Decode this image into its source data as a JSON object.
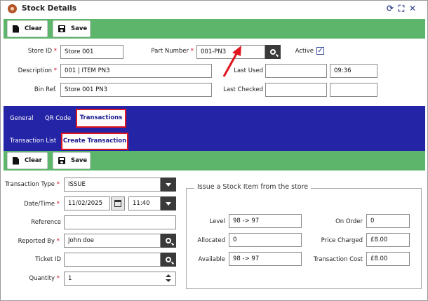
{
  "window": {
    "title": "Stock Details",
    "icon": "stock-gear-icon"
  },
  "title_controls": {
    "refresh": "refresh-icon",
    "expand": "expand-icon",
    "close": "close-icon"
  },
  "toolbar_top": {
    "clear_label": "Clear",
    "save_label": "Save"
  },
  "header_form": {
    "store_id": {
      "label": "Store ID",
      "value": "Store 001"
    },
    "part_number": {
      "label": "Part Number",
      "value": "001-PN3"
    },
    "active": {
      "label": "Active",
      "checked": true
    },
    "description": {
      "label": "Description",
      "value": "001 | ITEM PN3"
    },
    "last_used": {
      "label": "Last Used",
      "date": "",
      "time": "09:36"
    },
    "bin_ref": {
      "label": "Bin Ref.",
      "value": "Store 001 PN3"
    },
    "last_checked": {
      "label": "Last Checked",
      "date": "",
      "time": ""
    }
  },
  "tabs": [
    {
      "label": "General"
    },
    {
      "label": "QR Code"
    },
    {
      "label": "Transactions",
      "active": true
    }
  ],
  "subtabs": [
    {
      "label": "Transaction List"
    },
    {
      "label": "Create Transaction",
      "active": true
    }
  ],
  "toolbar_trans": {
    "clear_label": "Clear",
    "save_label": "Save"
  },
  "transaction_form": {
    "type": {
      "label": "Transaction Type",
      "value": "ISSUE"
    },
    "datetime": {
      "label": "Date/Time",
      "date": "11/02/2025",
      "time": "11:40"
    },
    "reference": {
      "label": "Reference",
      "value": ""
    },
    "reported_by": {
      "label": "Reported By",
      "value": "John doe"
    },
    "ticket_id": {
      "label": "Ticket ID",
      "value": ""
    },
    "quantity": {
      "label": "Quantity",
      "value": "1"
    }
  },
  "issue_group": {
    "title": "Issue a Stock Item from the store",
    "level": {
      "label": "Level",
      "value": "98 -> 97"
    },
    "allocated": {
      "label": "Allocated",
      "value": "0"
    },
    "available": {
      "label": "Available",
      "value": "98 -> 97"
    },
    "on_order": {
      "label": "On Order",
      "value": "0"
    },
    "price_charged": {
      "label": "Price Charged",
      "value": "£8.00"
    },
    "transaction_cost": {
      "label": "Transaction Cost",
      "value": "£8.00"
    }
  },
  "colors": {
    "accent_green": "#5cb56b",
    "nav_blue": "#2424a6",
    "highlight_red": "#e0141d",
    "required_red": "#d0021b"
  }
}
